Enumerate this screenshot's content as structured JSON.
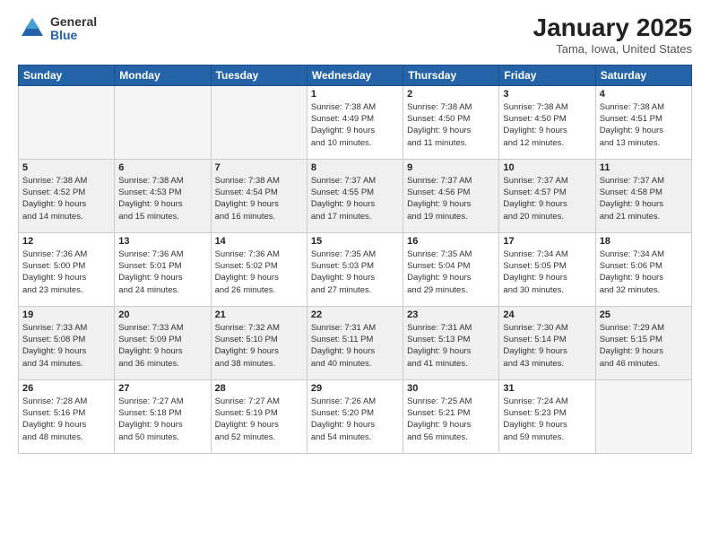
{
  "logo": {
    "general": "General",
    "blue": "Blue"
  },
  "header": {
    "month": "January 2025",
    "location": "Tama, Iowa, United States"
  },
  "weekdays": [
    "Sunday",
    "Monday",
    "Tuesday",
    "Wednesday",
    "Thursday",
    "Friday",
    "Saturday"
  ],
  "weeks": [
    [
      {
        "day": "",
        "info": ""
      },
      {
        "day": "",
        "info": ""
      },
      {
        "day": "",
        "info": ""
      },
      {
        "day": "1",
        "info": "Sunrise: 7:38 AM\nSunset: 4:49 PM\nDaylight: 9 hours\nand 10 minutes."
      },
      {
        "day": "2",
        "info": "Sunrise: 7:38 AM\nSunset: 4:50 PM\nDaylight: 9 hours\nand 11 minutes."
      },
      {
        "day": "3",
        "info": "Sunrise: 7:38 AM\nSunset: 4:50 PM\nDaylight: 9 hours\nand 12 minutes."
      },
      {
        "day": "4",
        "info": "Sunrise: 7:38 AM\nSunset: 4:51 PM\nDaylight: 9 hours\nand 13 minutes."
      }
    ],
    [
      {
        "day": "5",
        "info": "Sunrise: 7:38 AM\nSunset: 4:52 PM\nDaylight: 9 hours\nand 14 minutes."
      },
      {
        "day": "6",
        "info": "Sunrise: 7:38 AM\nSunset: 4:53 PM\nDaylight: 9 hours\nand 15 minutes."
      },
      {
        "day": "7",
        "info": "Sunrise: 7:38 AM\nSunset: 4:54 PM\nDaylight: 9 hours\nand 16 minutes."
      },
      {
        "day": "8",
        "info": "Sunrise: 7:37 AM\nSunset: 4:55 PM\nDaylight: 9 hours\nand 17 minutes."
      },
      {
        "day": "9",
        "info": "Sunrise: 7:37 AM\nSunset: 4:56 PM\nDaylight: 9 hours\nand 19 minutes."
      },
      {
        "day": "10",
        "info": "Sunrise: 7:37 AM\nSunset: 4:57 PM\nDaylight: 9 hours\nand 20 minutes."
      },
      {
        "day": "11",
        "info": "Sunrise: 7:37 AM\nSunset: 4:58 PM\nDaylight: 9 hours\nand 21 minutes."
      }
    ],
    [
      {
        "day": "12",
        "info": "Sunrise: 7:36 AM\nSunset: 5:00 PM\nDaylight: 9 hours\nand 23 minutes."
      },
      {
        "day": "13",
        "info": "Sunrise: 7:36 AM\nSunset: 5:01 PM\nDaylight: 9 hours\nand 24 minutes."
      },
      {
        "day": "14",
        "info": "Sunrise: 7:36 AM\nSunset: 5:02 PM\nDaylight: 9 hours\nand 26 minutes."
      },
      {
        "day": "15",
        "info": "Sunrise: 7:35 AM\nSunset: 5:03 PM\nDaylight: 9 hours\nand 27 minutes."
      },
      {
        "day": "16",
        "info": "Sunrise: 7:35 AM\nSunset: 5:04 PM\nDaylight: 9 hours\nand 29 minutes."
      },
      {
        "day": "17",
        "info": "Sunrise: 7:34 AM\nSunset: 5:05 PM\nDaylight: 9 hours\nand 30 minutes."
      },
      {
        "day": "18",
        "info": "Sunrise: 7:34 AM\nSunset: 5:06 PM\nDaylight: 9 hours\nand 32 minutes."
      }
    ],
    [
      {
        "day": "19",
        "info": "Sunrise: 7:33 AM\nSunset: 5:08 PM\nDaylight: 9 hours\nand 34 minutes."
      },
      {
        "day": "20",
        "info": "Sunrise: 7:33 AM\nSunset: 5:09 PM\nDaylight: 9 hours\nand 36 minutes."
      },
      {
        "day": "21",
        "info": "Sunrise: 7:32 AM\nSunset: 5:10 PM\nDaylight: 9 hours\nand 38 minutes."
      },
      {
        "day": "22",
        "info": "Sunrise: 7:31 AM\nSunset: 5:11 PM\nDaylight: 9 hours\nand 40 minutes."
      },
      {
        "day": "23",
        "info": "Sunrise: 7:31 AM\nSunset: 5:13 PM\nDaylight: 9 hours\nand 41 minutes."
      },
      {
        "day": "24",
        "info": "Sunrise: 7:30 AM\nSunset: 5:14 PM\nDaylight: 9 hours\nand 43 minutes."
      },
      {
        "day": "25",
        "info": "Sunrise: 7:29 AM\nSunset: 5:15 PM\nDaylight: 9 hours\nand 46 minutes."
      }
    ],
    [
      {
        "day": "26",
        "info": "Sunrise: 7:28 AM\nSunset: 5:16 PM\nDaylight: 9 hours\nand 48 minutes."
      },
      {
        "day": "27",
        "info": "Sunrise: 7:27 AM\nSunset: 5:18 PM\nDaylight: 9 hours\nand 50 minutes."
      },
      {
        "day": "28",
        "info": "Sunrise: 7:27 AM\nSunset: 5:19 PM\nDaylight: 9 hours\nand 52 minutes."
      },
      {
        "day": "29",
        "info": "Sunrise: 7:26 AM\nSunset: 5:20 PM\nDaylight: 9 hours\nand 54 minutes."
      },
      {
        "day": "30",
        "info": "Sunrise: 7:25 AM\nSunset: 5:21 PM\nDaylight: 9 hours\nand 56 minutes."
      },
      {
        "day": "31",
        "info": "Sunrise: 7:24 AM\nSunset: 5:23 PM\nDaylight: 9 hours\nand 59 minutes."
      },
      {
        "day": "",
        "info": ""
      }
    ]
  ]
}
